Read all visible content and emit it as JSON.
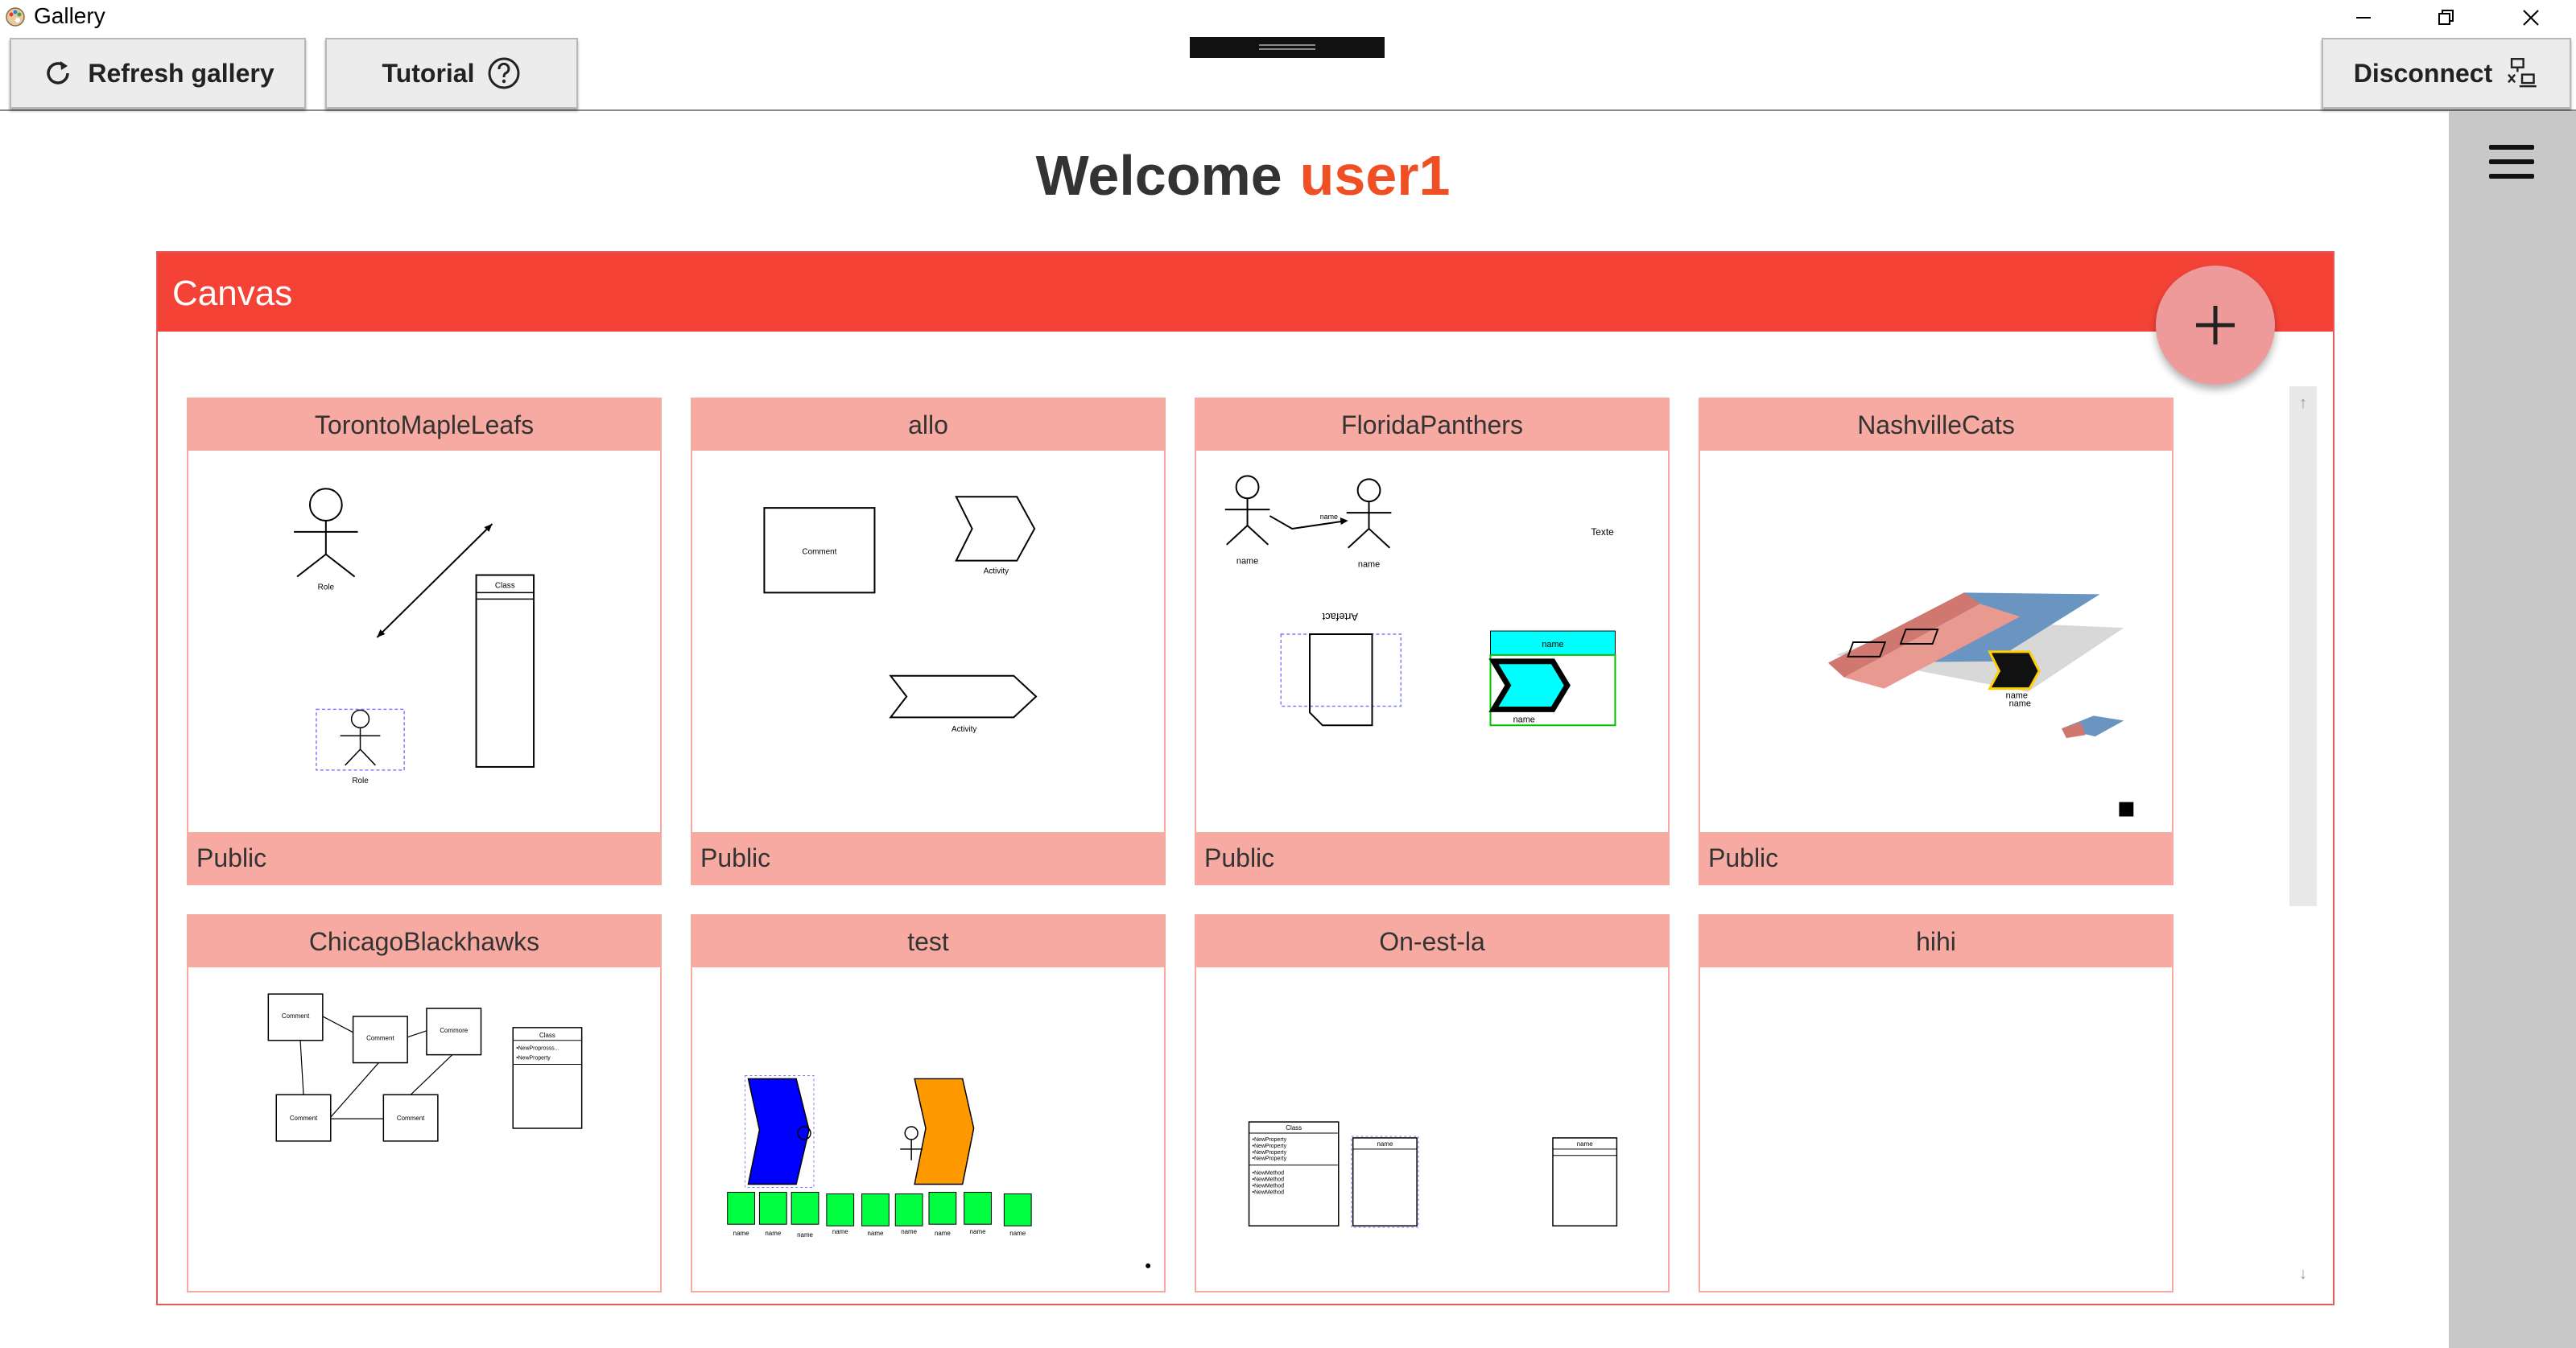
{
  "window": {
    "title": "Gallery"
  },
  "toolbar": {
    "refresh_label": "Refresh gallery",
    "tutorial_label": "Tutorial",
    "disconnect_label": "Disconnect"
  },
  "welcome": {
    "text": "Welcome",
    "user": "user1"
  },
  "canvas": {
    "title": "Canvas"
  },
  "colors": {
    "accent": "#f44336",
    "card": "#f7aaa2",
    "user": "#f04e23",
    "fab": "#ef9a9a"
  },
  "cards": [
    {
      "title": "TorontoMapleLeafs",
      "visibility": "Public",
      "labels": [
        "Role",
        "Class",
        "Role"
      ]
    },
    {
      "title": "allo",
      "visibility": "Public",
      "labels": [
        "Comment",
        "Activity",
        "Activity"
      ]
    },
    {
      "title": "FloridaPanthers",
      "visibility": "Public",
      "labels": [
        "name",
        "name",
        "name",
        "Texte",
        "Artefact",
        "name",
        "name"
      ]
    },
    {
      "title": "NashvilleCats",
      "visibility": "Public",
      "labels": [
        "name",
        "name"
      ]
    },
    {
      "title": "ChicagoBlackhawks",
      "labels": [
        "Comment",
        "Comment",
        "Commore",
        "Comment",
        "Comment",
        "Class",
        "•NewProprosss...",
        "•NewProperty"
      ]
    },
    {
      "title": "test",
      "labels": [
        "name",
        "name",
        "name",
        "name",
        "name",
        "name",
        "name",
        "name",
        "name"
      ]
    },
    {
      "title": "On-est-la",
      "labels": [
        "Class",
        "•NewProperty",
        "•NewProperty",
        "•NewProperty",
        "•NewProperty",
        "•NewMethod",
        "•NewMethod",
        "•NewMethod",
        "•NewMethod",
        "name",
        "name"
      ]
    },
    {
      "title": "hihi",
      "labels": []
    }
  ]
}
